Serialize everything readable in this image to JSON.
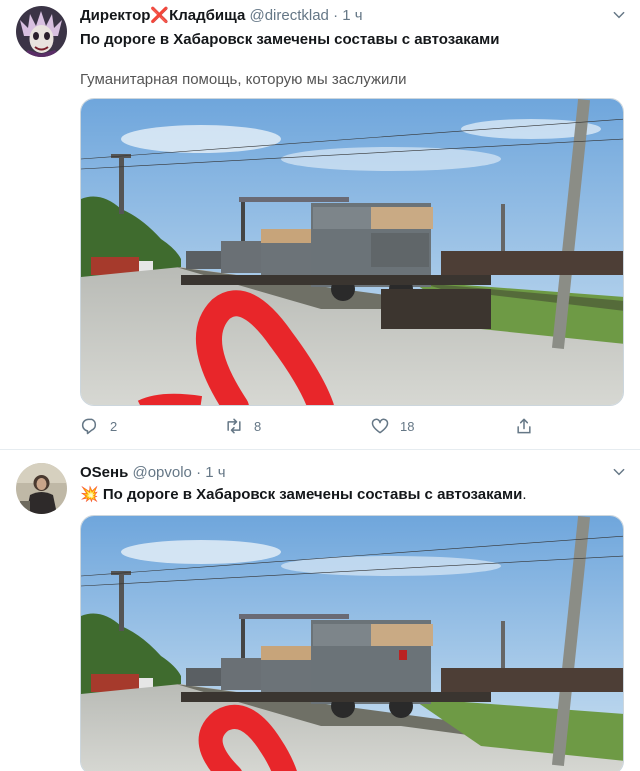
{
  "tweets": [
    {
      "author_name": "Директор❌Кладбища",
      "handle": "@directklad",
      "separator": "·",
      "time": "1 ч",
      "headline": "По дороге в Хабаровск замечены составы с автозаками",
      "body": "Гуманитарная помощь, которую мы заслужили",
      "replies": "2",
      "retweets": "8",
      "likes": "18"
    },
    {
      "author_name": "OSень",
      "handle": "@opvolo",
      "separator": "·",
      "time": "1 ч",
      "emoji": "💥",
      "headline": "По дороге в Хабаровск замечены составы с автозаками",
      "headline_period": "."
    }
  ],
  "colors": {
    "accent": "#1da1f2",
    "secondary_text": "#657786",
    "divider": "#e6ecf0",
    "annotation_red": "#e8262a"
  },
  "icons": [
    "reply-icon",
    "retweet-icon",
    "like-icon",
    "share-icon",
    "caret-down-icon"
  ]
}
